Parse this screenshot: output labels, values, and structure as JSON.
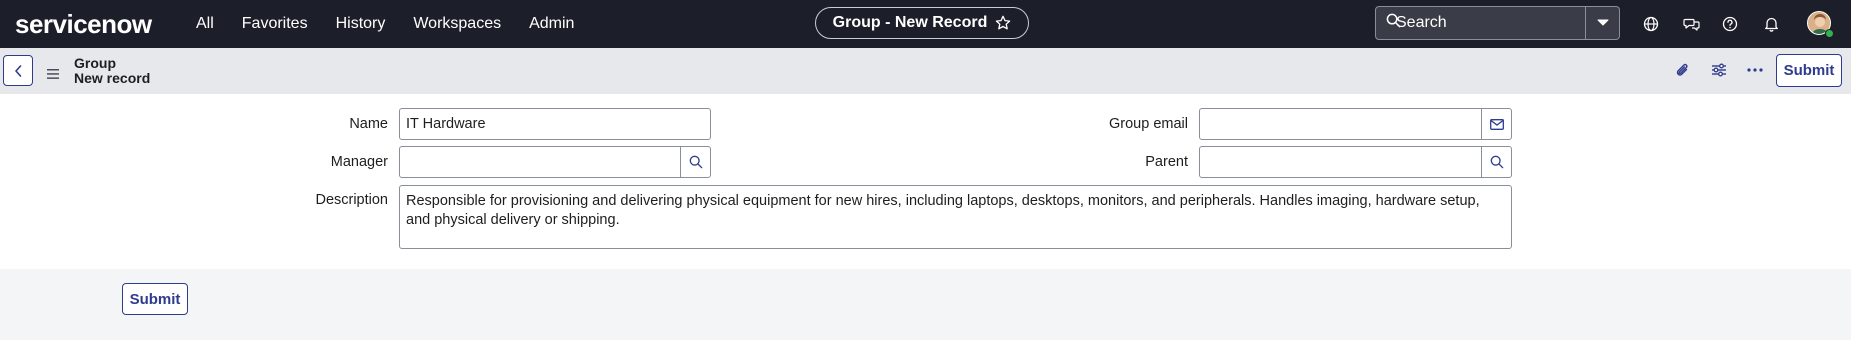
{
  "app": {
    "logo_text": "servicenow"
  },
  "nav": {
    "items": [
      "All",
      "Favorites",
      "History",
      "Workspaces",
      "Admin"
    ],
    "record_title": "Group - New Record",
    "search_placeholder": "Search"
  },
  "header": {
    "title_line1": "Group",
    "title_line2": "New record",
    "submit_label": "Submit"
  },
  "form": {
    "name_label": "Name",
    "name_value": "IT Hardware",
    "manager_label": "Manager",
    "manager_value": "",
    "group_email_label": "Group email",
    "group_email_value": "",
    "parent_label": "Parent",
    "parent_value": "",
    "description_label": "Description",
    "description_value": "Responsible for provisioning and delivering physical equipment for new hires, including laptops, desktops, monitors, and peripherals. Handles imaging, hardware setup, and physical delivery or shipping."
  },
  "footer": {
    "submit_label": "Submit"
  },
  "icons": {
    "star": "star-outline-icon",
    "search": "magnifier-icon",
    "globe": "globe-icon",
    "chat": "chat-bubbles-icon",
    "help": "question-circle-icon",
    "bell": "bell-icon",
    "attachment": "paperclip-icon",
    "settings": "sliders-icon",
    "more": "ellipsis-icon",
    "email": "envelope-icon",
    "back": "chevron-left-icon",
    "menu": "hamburger-icon"
  },
  "colors": {
    "nav_bg": "#1c1f2a",
    "accent": "#2f3b8f",
    "presence": "#2fb34a"
  }
}
